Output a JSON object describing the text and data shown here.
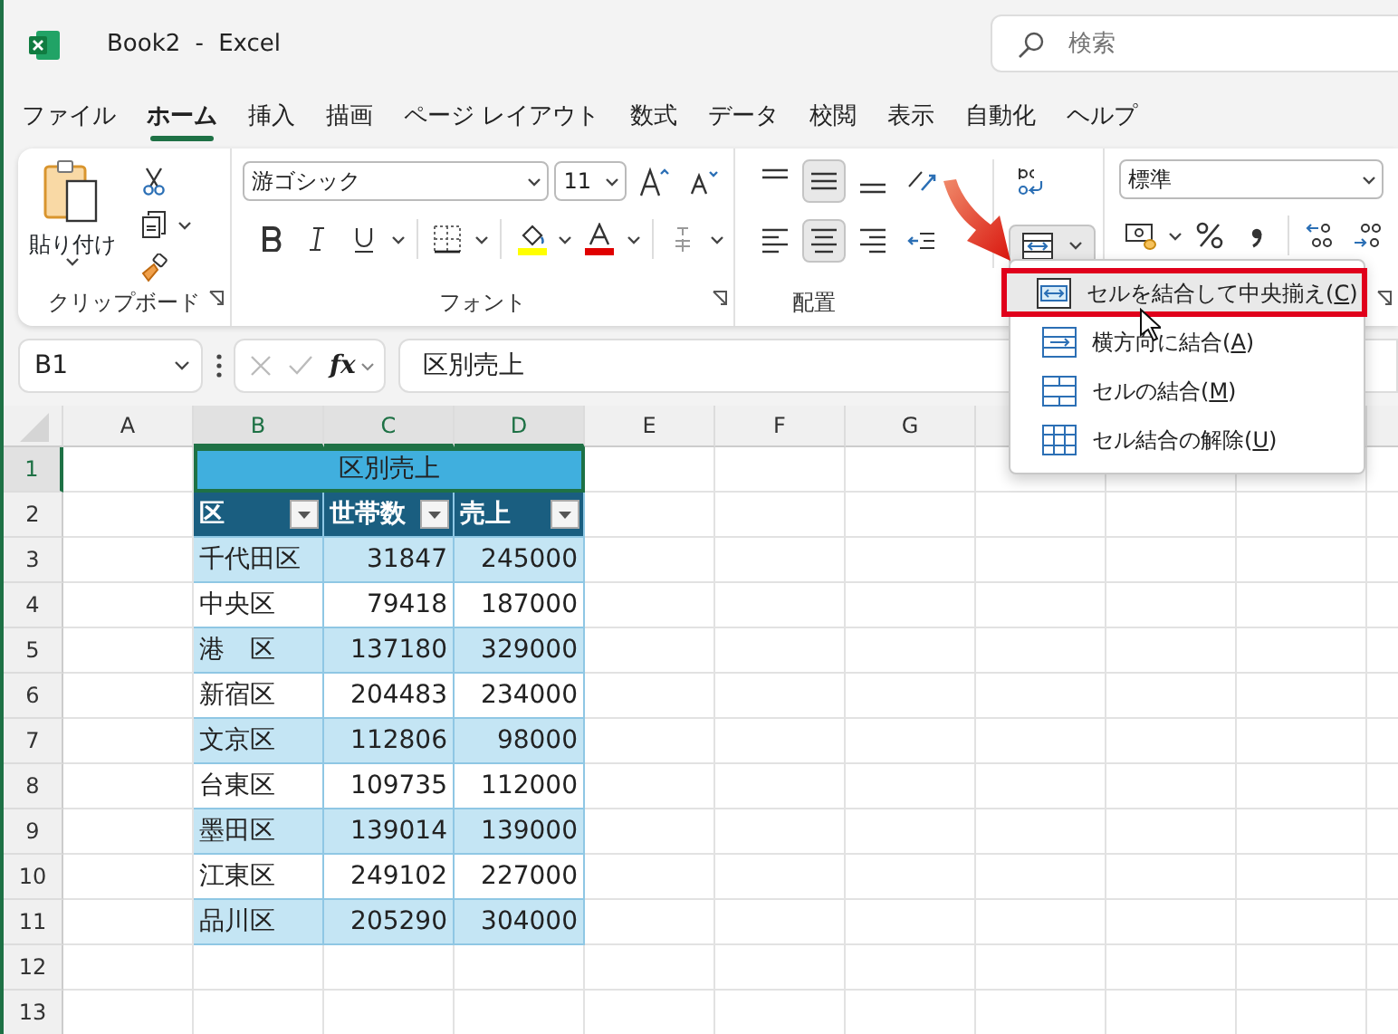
{
  "window": {
    "title": "Book2 - Excel"
  },
  "search": {
    "placeholder": "検索"
  },
  "tabs": [
    {
      "label": "ファイル",
      "selected": false
    },
    {
      "label": "ホーム",
      "selected": true
    },
    {
      "label": "挿入",
      "selected": false
    },
    {
      "label": "描画",
      "selected": false
    },
    {
      "label": "ページ レイアウト",
      "selected": false
    },
    {
      "label": "数式",
      "selected": false
    },
    {
      "label": "データ",
      "selected": false
    },
    {
      "label": "校閲",
      "selected": false
    },
    {
      "label": "表示",
      "selected": false
    },
    {
      "label": "自動化",
      "selected": false
    },
    {
      "label": "ヘルプ",
      "selected": false
    }
  ],
  "clipboard": {
    "paste_label": "貼り付け",
    "group_label": "クリップボード"
  },
  "font": {
    "font_name": "游ゴシック",
    "font_size": "11",
    "group_label": "フォント"
  },
  "alignment": {
    "group_label": "配置",
    "vertical": [
      {
        "kind": "top",
        "selected": false
      },
      {
        "kind": "middle",
        "selected": true
      },
      {
        "kind": "bottom",
        "selected": false
      }
    ],
    "horizontal": [
      {
        "kind": "left",
        "selected": false
      },
      {
        "kind": "center",
        "selected": true
      },
      {
        "kind": "right",
        "selected": false
      }
    ],
    "merge_pressed": true
  },
  "number": {
    "format": "標準"
  },
  "formula_bar": {
    "name_box": "B1",
    "function_label": "fx",
    "formula": "区別売上"
  },
  "sheet": {
    "columns": [
      "A",
      "B",
      "C",
      "D",
      "E",
      "F",
      "G"
    ],
    "row_numbers": [
      "1",
      "2",
      "3",
      "4",
      "5",
      "6",
      "7",
      "8",
      "9",
      "10",
      "11",
      "12",
      "13"
    ],
    "table": {
      "title": "区別売上",
      "headers": [
        "区",
        "世帯数",
        "売上"
      ],
      "rows": [
        [
          "千代田区",
          "31847",
          "245000"
        ],
        [
          "中央区",
          "79418",
          "187000"
        ],
        [
          "港　区",
          "137180",
          "329000"
        ],
        [
          "新宿区",
          "204483",
          "234000"
        ],
        [
          "文京区",
          "112806",
          "98000"
        ],
        [
          "台東区",
          "109735",
          "112000"
        ],
        [
          "墨田区",
          "139014",
          "139000"
        ],
        [
          "江東区",
          "249102",
          "227000"
        ],
        [
          "品川区",
          "205290",
          "304000"
        ]
      ]
    }
  },
  "merge_menu": {
    "items": [
      {
        "kind": "merge-center",
        "text": "セルを結合して中央揃え(",
        "access_key": "C",
        "text_end": ")",
        "selected": true
      },
      {
        "kind": "merge-across",
        "text": "横方向に結合(",
        "access_key": "A",
        "text_end": ")",
        "selected": false
      },
      {
        "kind": "merge",
        "text": "セルの結合(",
        "access_key": "M",
        "text_end": ")",
        "selected": false
      },
      {
        "kind": "unmerge",
        "text": "セル結合の解除(",
        "access_key": "U",
        "text_end": ")",
        "selected": false
      }
    ]
  }
}
